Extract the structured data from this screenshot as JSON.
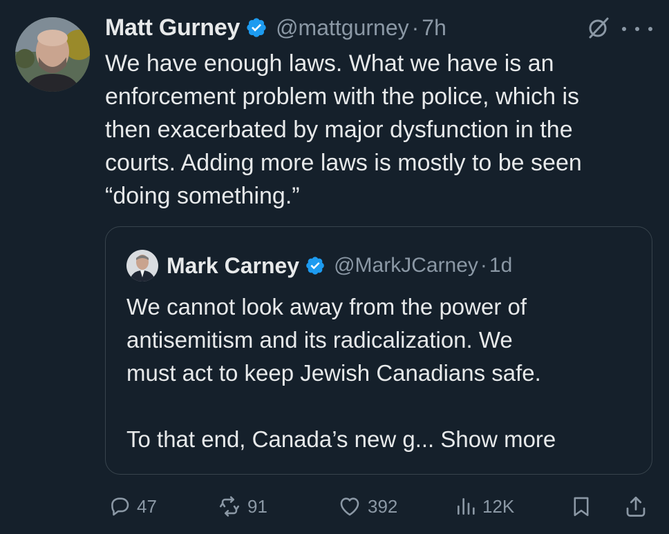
{
  "author": {
    "name": "Matt Gurney",
    "handle": "@mattgurney",
    "separator": "·",
    "time": "7h"
  },
  "tweet": {
    "lines": [
      "We have enough laws. What we have is an",
      "enforcement problem with the police, which is",
      "then exacerbated by major dysfunction in the",
      "courts. Adding more laws is mostly to be seen",
      "“doing something.”"
    ]
  },
  "quoted": {
    "name": "Mark Carney",
    "handle": "@MarkJCarney",
    "separator": "·",
    "time": "1d",
    "lines": [
      "We cannot look away from the power of",
      "antisemitism and its radicalization. We",
      "must act to keep Jewish Canadians safe."
    ],
    "last_line_prefix": "To that end, Canada’s new g...",
    "show_more": "Show more"
  },
  "actions": {
    "replies": "47",
    "reposts": "91",
    "likes": "392",
    "views": "12K"
  },
  "colors": {
    "background": "#15202b",
    "text": "#e7e9ea",
    "muted": "#8b98a5",
    "verified": "#1d9bf0",
    "border": "#38444d"
  },
  "icons": {
    "verified": "verified-badge-icon",
    "grok": "grok-icon",
    "more": "more-options-icon",
    "reply": "reply-icon",
    "repost": "repost-icon",
    "like": "heart-icon",
    "views": "views-icon",
    "bookmark": "bookmark-icon",
    "share": "share-icon"
  }
}
